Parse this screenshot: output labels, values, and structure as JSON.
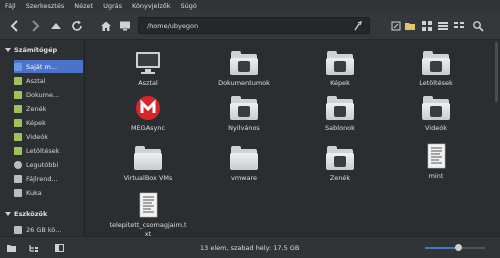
{
  "menu": [
    "Fájl",
    "Szerkesztés",
    "Nézet",
    "Ugrás",
    "Könyvjelzők",
    "Súgó"
  ],
  "location": {
    "path": "/home/ubyegon"
  },
  "sidebar": {
    "computer_header": "Számítógép",
    "items": [
      {
        "label": "Saját m...",
        "color": "#6b9bd8"
      },
      {
        "label": "Asztal",
        "color": "#9fc35a"
      },
      {
        "label": "Dokume...",
        "color": "#9fc35a"
      },
      {
        "label": "Zenék",
        "color": "#9fc35a"
      },
      {
        "label": "Képek",
        "color": "#9fc35a"
      },
      {
        "label": "Videók",
        "color": "#9fc35a"
      },
      {
        "label": "Letöltések",
        "color": "#9fc35a"
      },
      {
        "label": "Legutóbbi",
        "color": "#bdbdbd"
      },
      {
        "label": "Fájlrend...",
        "color": "#bdbdbd"
      },
      {
        "label": "Kuka",
        "color": "#bdbdbd"
      }
    ],
    "devices_header": "Eszközök",
    "devices": [
      {
        "label": "26 GB kö...",
        "color": "#bdbdbd"
      }
    ]
  },
  "files": [
    {
      "label": "Asztal",
      "icon": "monitor-icon"
    },
    {
      "label": "Dokumentumok",
      "icon": "documents-folder-icon"
    },
    {
      "label": "Képek",
      "icon": "pictures-folder-icon"
    },
    {
      "label": "Letöltések",
      "icon": "downloads-folder-icon"
    },
    {
      "label": "MEGAsync",
      "icon": "mega-icon"
    },
    {
      "label": "Nyilvános",
      "icon": "public-folder-icon"
    },
    {
      "label": "Sablonok",
      "icon": "templates-folder-icon"
    },
    {
      "label": "Videók",
      "icon": "videos-folder-icon"
    },
    {
      "label": "VirtualBox VMs",
      "icon": "folder-icon"
    },
    {
      "label": "vmware",
      "icon": "folder-icon"
    },
    {
      "label": "Zenék",
      "icon": "music-folder-icon"
    },
    {
      "label": "mint",
      "icon": "text-file-icon"
    },
    {
      "label": "telepitett_csomagjaim.txt",
      "icon": "text-file-icon"
    }
  ],
  "status": {
    "text": "13 elem, szabad hely: 17,5 GB",
    "zoom_level": 0.55
  },
  "colors": {
    "accent": "#4a74c9",
    "mega_red": "#d9252a"
  }
}
